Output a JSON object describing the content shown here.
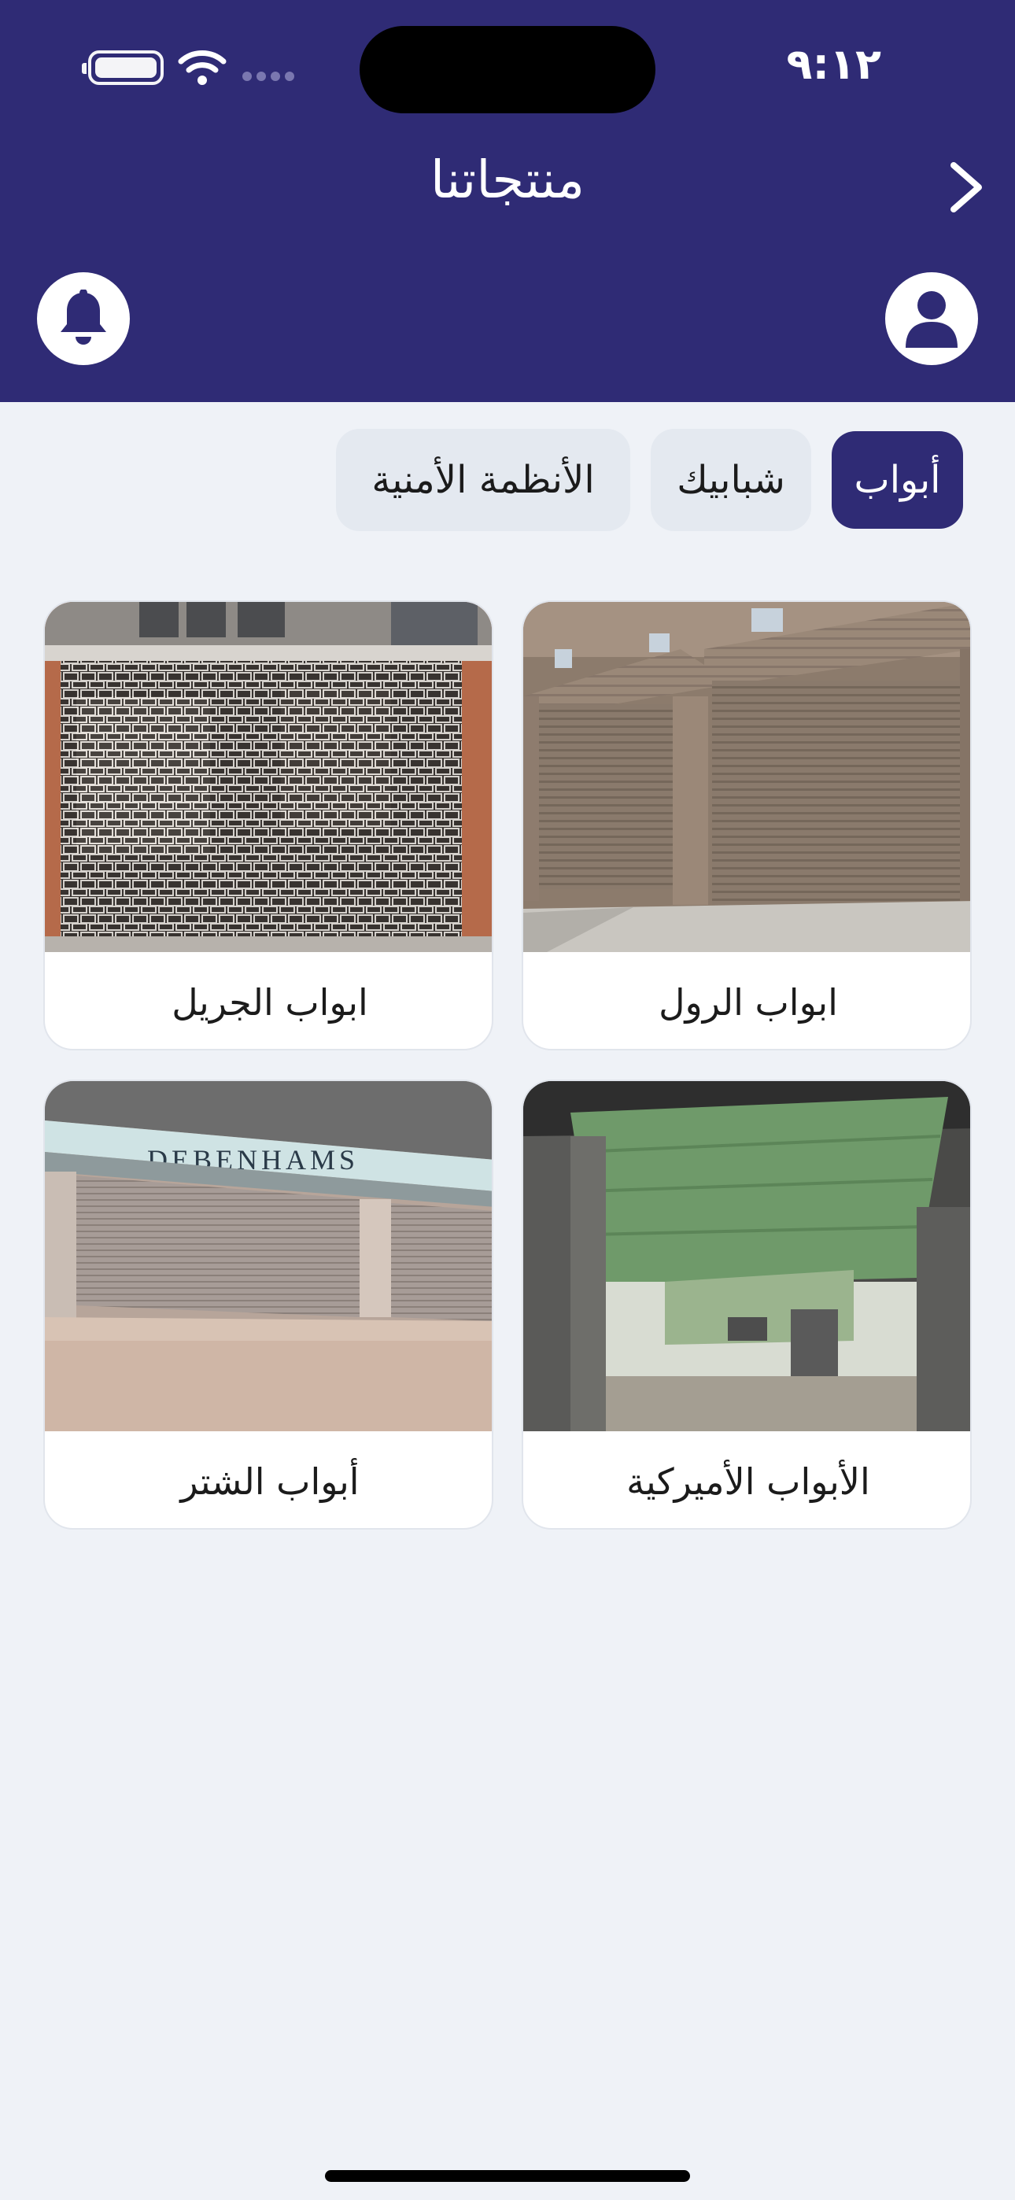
{
  "status_bar": {
    "time": "٩:١٢"
  },
  "header": {
    "title": "منتجاتنا"
  },
  "tabs": [
    {
      "label": "أبواب",
      "active": true
    },
    {
      "label": "شبابيك",
      "active": false
    },
    {
      "label": "الأنظمة الأمنية",
      "active": false
    }
  ],
  "products": [
    {
      "label": "ابواب الرول"
    },
    {
      "label": "ابواب الجريل"
    },
    {
      "label": "الأبواب الأميركية"
    },
    {
      "label": "أبواب الشتر"
    }
  ],
  "image_texts": {
    "store_sign": "DEBENHAMS"
  },
  "colors": {
    "primary": "#2f2b75",
    "background": "#eff2f7",
    "tab_inactive": "#e4e9f0"
  },
  "icons": [
    "battery-icon",
    "wifi-icon",
    "signal-icon",
    "chevron-right-icon",
    "user-icon",
    "bell-icon"
  ]
}
